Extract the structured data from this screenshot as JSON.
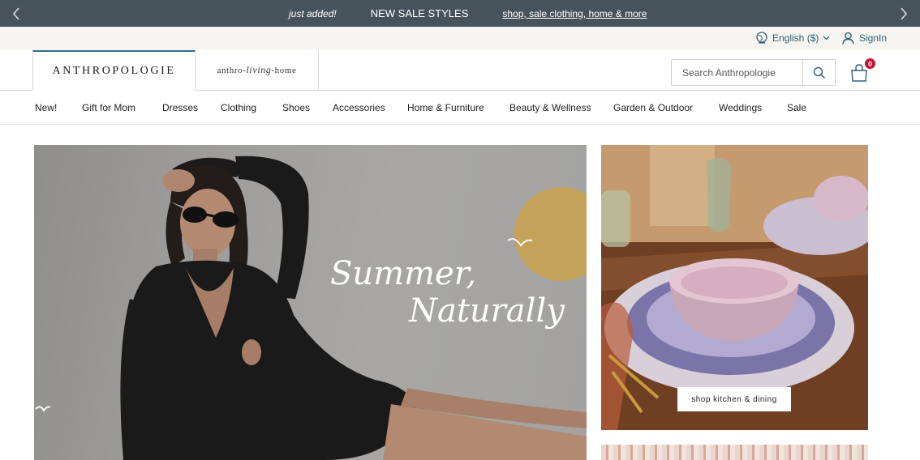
{
  "promo": {
    "just_added": "just added!",
    "headline": "NEW SALE STYLES",
    "link": "shop, sale clothing, home & more"
  },
  "utility": {
    "language": "English ($)",
    "signin": "SignIn"
  },
  "brands": {
    "main": "ANTHROPOLOGIE",
    "alt_prefix": "anthro",
    "alt_script": "living",
    "alt_suffix": "home"
  },
  "search": {
    "placeholder": "Search Anthropologie"
  },
  "cart": {
    "count": "0"
  },
  "nav": {
    "items": [
      "New!",
      "Gift for Mom",
      "Dresses",
      "Clothing",
      "Shoes",
      "Accessories",
      "Home & Furniture",
      "Beauty & Wellness",
      "Garden & Outdoor",
      "Weddings",
      "Sale"
    ]
  },
  "hero": {
    "script_line1": "Summer,",
    "script_line2": "Naturally"
  },
  "side_promo": {
    "button": "shop kitchen & dining"
  },
  "colors": {
    "promo_bar": "#46535a",
    "utility_bar": "#f7f5f1",
    "accent_link": "#2f5f7a",
    "brand_tab_top": "#2f6f86",
    "cart_badge": "#c8102e"
  }
}
